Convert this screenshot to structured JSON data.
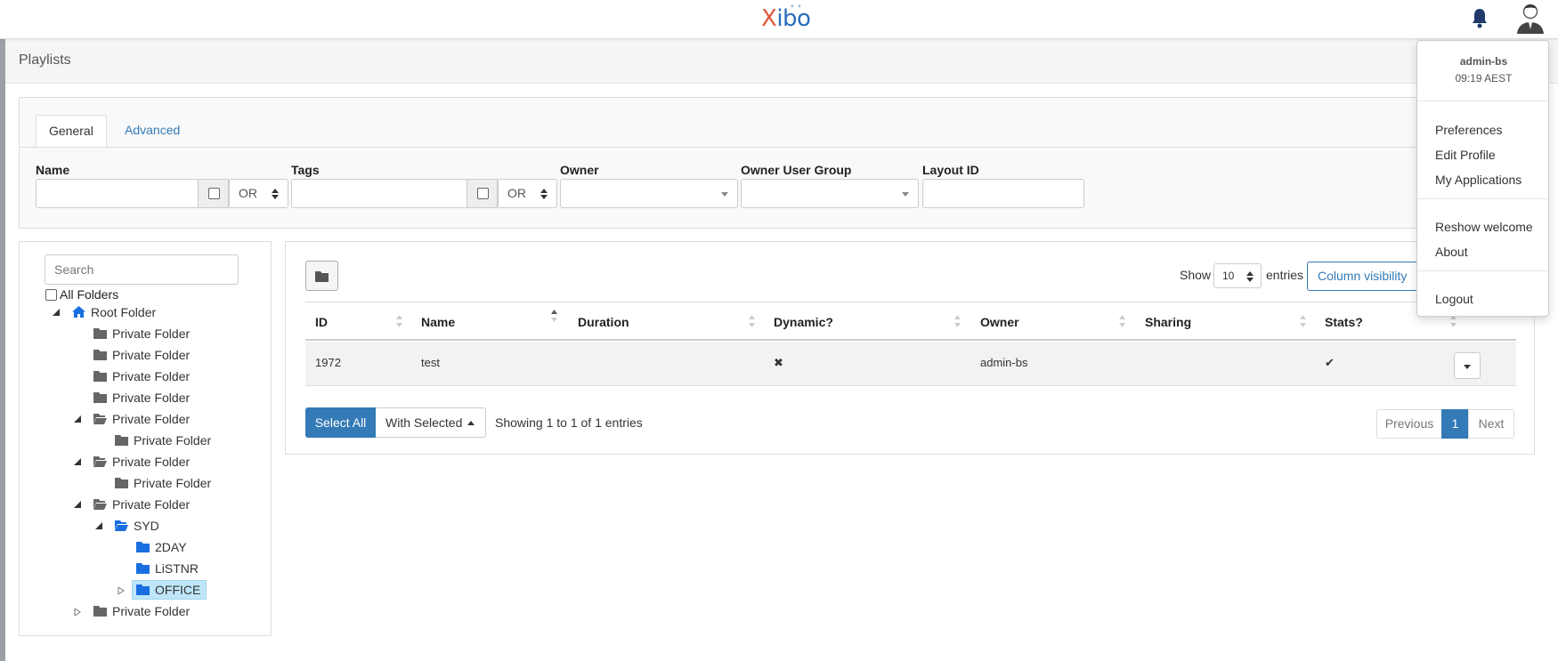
{
  "brand": {
    "logo_x": "X",
    "logo_rest": "ibo",
    "logo_dots": "° °"
  },
  "page": {
    "title": "Playlists"
  },
  "filters": {
    "tabs": [
      {
        "label": "General"
      },
      {
        "label": "Advanced"
      }
    ],
    "name_label": "Name",
    "tags_label": "Tags",
    "owner_label": "Owner",
    "owner_group_label": "Owner User Group",
    "layout_id_label": "Layout ID",
    "name_logic": "OR",
    "tags_logic": "OR"
  },
  "tree": {
    "search_placeholder": "Search",
    "all_folders_label": "All Folders",
    "root": "Root Folder",
    "private": "Private Folder",
    "syd": "SYD",
    "day2": "2DAY",
    "listnr": "LiSTNR",
    "office": "OFFICE"
  },
  "table": {
    "show_label": "Show",
    "entries_value": "10",
    "entries_label": "entries",
    "column_visibility": "Column visibility",
    "columns": [
      "ID",
      "Name",
      "Duration",
      "Dynamic?",
      "Owner",
      "Sharing",
      "Stats?"
    ],
    "rows": [
      {
        "id": "1972",
        "name": "test",
        "duration": "",
        "dynamic": "✖",
        "owner": "admin-bs",
        "sharing": "",
        "stats": "✔"
      }
    ],
    "select_all": "Select All",
    "with_selected": "With Selected",
    "showing": "Showing 1 to 1 of 1 entries",
    "pager": {
      "previous": "Previous",
      "current": "1",
      "next": "Next"
    }
  },
  "user_menu": {
    "username": "admin-bs",
    "time": "09:19 AEST",
    "items": [
      "Preferences",
      "Edit Profile",
      "My Applications",
      "Reshow welcome",
      "About",
      "Logout"
    ]
  },
  "colors": {
    "primary": "#337ab7",
    "folder_blue": "#1a6fe0",
    "folder_grey": "#666666",
    "selected_bg": "#bfe6f8"
  }
}
